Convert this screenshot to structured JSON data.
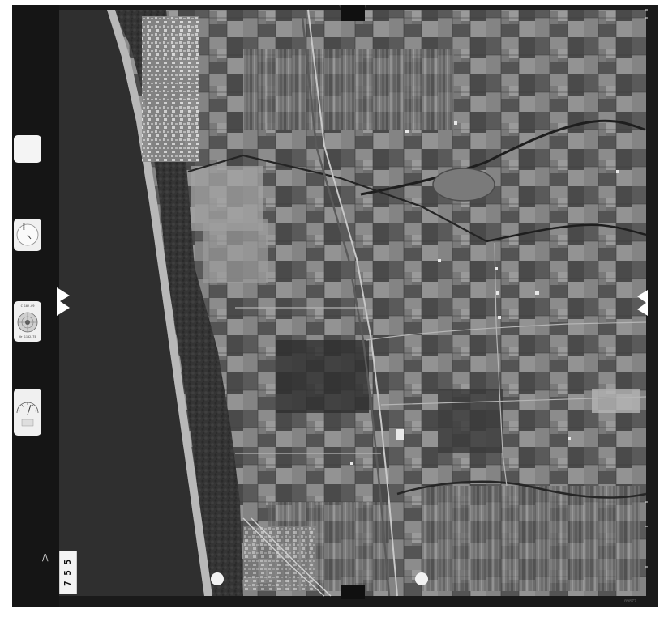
{
  "frame": {
    "number": "7 5 5",
    "pencil_mark": "/\\",
    "edge_code": "09877"
  },
  "instrument_panel": {
    "camera_label": "C 102.09",
    "camera_serial": "Nr 1102/75",
    "altimeter_label": "1000",
    "fiducial_marks": [
      "top",
      "left",
      "right",
      "bottom"
    ]
  },
  "colors": {
    "film_border": "#1a1a1a",
    "sea": "#2f2f2f",
    "beach": "#b8b8b8",
    "scan_background": "#ffffff"
  },
  "features": [
    "sea",
    "beach",
    "coastal-pine-forest",
    "town",
    "canal",
    "agricultural-fields",
    "railway",
    "road"
  ]
}
